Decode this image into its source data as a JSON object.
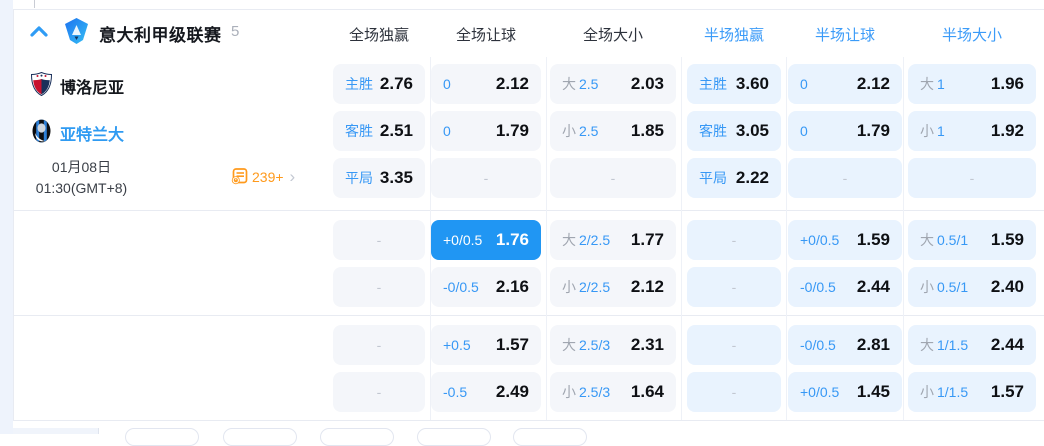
{
  "league": {
    "name": "意大利甲级联赛",
    "count": "5"
  },
  "columns": {
    "full_win": "全场独赢",
    "full_handicap": "全场让球",
    "full_ou": "全场大小",
    "half_win": "半场独赢",
    "half_handicap": "半场让球",
    "half_ou": "半场大小"
  },
  "match": {
    "home": "博洛尼亚",
    "away": "亚特兰大",
    "date_line1": "01月08日",
    "date_line2": "01:30(GMT+8)",
    "more_count": "239+",
    "more_arrow": "›"
  },
  "colors": {
    "accent_blue": "#3798f5",
    "selected_cell": "#2096f3",
    "half_cell_bg": "#e9f3fe",
    "full_cell_bg": "#f4f6fa",
    "orange": "#ff9a1c"
  },
  "s1": {
    "rows": [
      {
        "c1": {
          "l": "主胜",
          "v": "2.76"
        },
        "c2": {
          "l": "0",
          "v": "2.12"
        },
        "c3": {
          "g": "大",
          "l": "2.5",
          "v": "2.03"
        },
        "c4": {
          "l": "主胜",
          "v": "3.60"
        },
        "c5": {
          "l": "0",
          "v": "2.12"
        },
        "c6": {
          "g": "大",
          "l": "1",
          "v": "1.96"
        }
      },
      {
        "c1": {
          "l": "客胜",
          "v": "2.51"
        },
        "c2": {
          "l": "0",
          "v": "1.79"
        },
        "c3": {
          "g": "小",
          "l": "2.5",
          "v": "1.85"
        },
        "c4": {
          "l": "客胜",
          "v": "3.05"
        },
        "c5": {
          "l": "0",
          "v": "1.79"
        },
        "c6": {
          "g": "小",
          "l": "1",
          "v": "1.92"
        }
      },
      {
        "c1": {
          "l": "平局",
          "v": "3.35"
        },
        "c2": {
          "v": "-"
        },
        "c3": {
          "v": "-"
        },
        "c4": {
          "l": "平局",
          "v": "2.22"
        },
        "c5": {
          "v": "-"
        },
        "c6": {
          "v": "-"
        }
      }
    ]
  },
  "s2": {
    "rows": [
      {
        "c1": {
          "v": "-"
        },
        "c2": {
          "l": "+0/0.5",
          "v": "1.76",
          "selected": true
        },
        "c3": {
          "g": "大",
          "l": "2/2.5",
          "v": "1.77"
        },
        "c4": {
          "v": "-"
        },
        "c5": {
          "l": "+0/0.5",
          "v": "1.59"
        },
        "c6": {
          "g": "大",
          "l": "0.5/1",
          "v": "1.59"
        }
      },
      {
        "c1": {
          "v": "-"
        },
        "c2": {
          "l": "-0/0.5",
          "v": "2.16"
        },
        "c3": {
          "g": "小",
          "l": "2/2.5",
          "v": "2.12"
        },
        "c4": {
          "v": "-"
        },
        "c5": {
          "l": "-0/0.5",
          "v": "2.44"
        },
        "c6": {
          "g": "小",
          "l": "0.5/1",
          "v": "2.40"
        }
      }
    ]
  },
  "s3": {
    "rows": [
      {
        "c1": {
          "v": "-"
        },
        "c2": {
          "l": "+0.5",
          "v": "1.57"
        },
        "c3": {
          "g": "大",
          "l": "2.5/3",
          "v": "2.31"
        },
        "c4": {
          "v": "-"
        },
        "c5": {
          "l": "-0/0.5",
          "v": "2.81"
        },
        "c6": {
          "g": "大",
          "l": "1/1.5",
          "v": "2.44"
        }
      },
      {
        "c1": {
          "v": "-"
        },
        "c2": {
          "l": "-0.5",
          "v": "2.49"
        },
        "c3": {
          "g": "小",
          "l": "2.5/3",
          "v": "1.64"
        },
        "c4": {
          "v": "-"
        },
        "c5": {
          "l": "+0/0.5",
          "v": "1.45"
        },
        "c6": {
          "g": "小",
          "l": "1/1.5",
          "v": "1.57"
        }
      }
    ]
  }
}
